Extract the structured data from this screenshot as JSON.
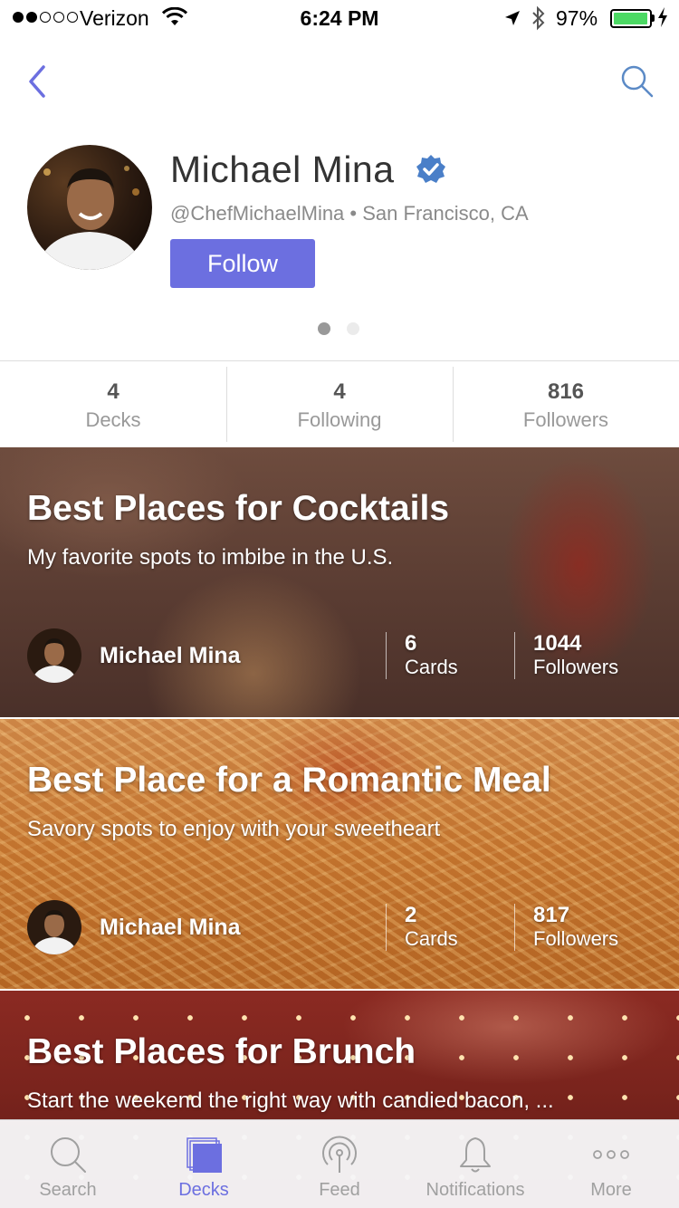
{
  "status_bar": {
    "carrier": "Verizon",
    "time": "6:24 PM",
    "battery_percent": "97%",
    "battery_level": 0.97,
    "signal_strength": 2
  },
  "nav": {
    "back_icon": "chevron-left-icon",
    "search_icon": "search-icon"
  },
  "profile": {
    "name": "Michael Mina",
    "handle": "@ChefMichaelMina",
    "separator": "•",
    "location": "San Francisco, CA",
    "follow_label": "Follow",
    "verified": true
  },
  "pager": {
    "count": 2,
    "active_index": 0
  },
  "stats": [
    {
      "value": "4",
      "label": "Decks"
    },
    {
      "value": "4",
      "label": "Following"
    },
    {
      "value": "816",
      "label": "Followers"
    }
  ],
  "decks": [
    {
      "title": "Best Places for Cocktails",
      "subtitle": "My favorite spots to imbibe in the U.S.",
      "author": "Michael Mina",
      "cards_count": "6",
      "cards_label": "Cards",
      "followers_count": "1044",
      "followers_label": "Followers"
    },
    {
      "title": "Best Place for a Romantic Meal",
      "subtitle": "Savory spots to enjoy with your sweetheart",
      "author": "Michael Mina",
      "cards_count": "2",
      "cards_label": "Cards",
      "followers_count": "817",
      "followers_label": "Followers"
    },
    {
      "title": "Best Places for Brunch",
      "subtitle": "Start the weekend the right way with candied bacon, ..."
    }
  ],
  "tab_bar": {
    "accent": "#6c6fe0",
    "inactive_color": "#a0a0a0",
    "tabs": [
      {
        "label": "Search",
        "icon": "search-icon",
        "active": false
      },
      {
        "label": "Decks",
        "icon": "decks-icon",
        "active": true
      },
      {
        "label": "Feed",
        "icon": "feed-broadcast-icon",
        "active": false
      },
      {
        "label": "Notifications",
        "icon": "bell-icon",
        "active": false
      },
      {
        "label": "More",
        "icon": "more-dots-icon",
        "active": false
      }
    ]
  },
  "colors": {
    "accent": "#6c6fe0",
    "battery": "#4cd964"
  }
}
